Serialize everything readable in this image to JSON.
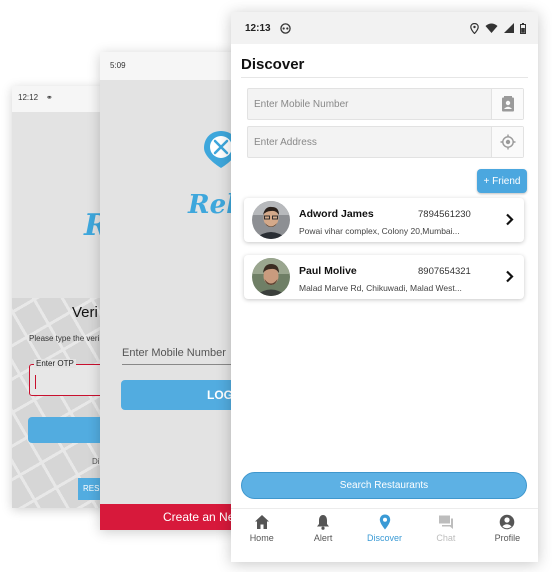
{
  "back_screen_otp": {
    "time": "12:12",
    "title": "Veri",
    "subtitle": "Please type the veri",
    "otp_label": "Enter OTP",
    "footer_text": "Di",
    "resend_label": "RES",
    "logo_text": "Re"
  },
  "back_screen_login": {
    "time": "5:09",
    "logo_text": "Rel",
    "mobile_placeholder": "Enter Mobile Number",
    "login_label": "LOG",
    "create_label": "Create an Ne"
  },
  "discover_screen": {
    "status": {
      "time": "12:13"
    },
    "page_title": "Discover",
    "mobile_field": {
      "placeholder": "Enter Mobile Number",
      "value": ""
    },
    "address_field": {
      "placeholder": "Enter Address",
      "value": ""
    },
    "friend_button": "+ Friend",
    "contacts": [
      {
        "name": "Adword James",
        "phone": "7894561230",
        "address": "Powai vihar complex, Colony 20,Mumbai..."
      },
      {
        "name": "Paul Molive",
        "phone": "8907654321",
        "address": "Malad Marve Rd, Chikuwadi, Malad West..."
      }
    ],
    "search_button": "Search Restaurants",
    "nav": [
      {
        "label": "Home",
        "icon": "home-icon",
        "state": "normal"
      },
      {
        "label": "Alert",
        "icon": "bell-icon",
        "state": "normal"
      },
      {
        "label": "Discover",
        "icon": "location-pin-icon",
        "state": "active"
      },
      {
        "label": "Chat",
        "icon": "chat-icon",
        "state": "disabled"
      },
      {
        "label": "Profile",
        "icon": "profile-icon",
        "state": "normal"
      }
    ]
  },
  "colors": {
    "accent_blue": "#4ba7df",
    "active_nav": "#3a9ad5",
    "create_red": "#d7193b",
    "otp_border": "#c8102e"
  }
}
